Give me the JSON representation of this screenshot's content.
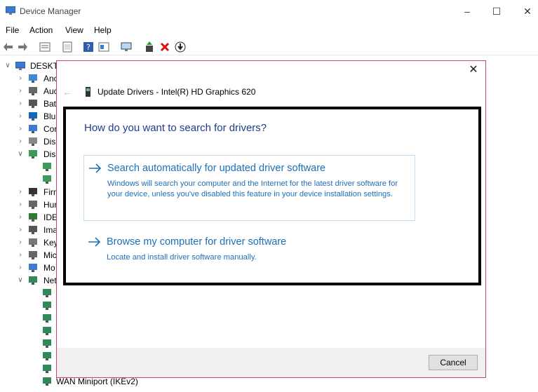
{
  "window": {
    "title": "Device Manager"
  },
  "menu": [
    "File",
    "Action",
    "View",
    "Help"
  ],
  "tree": {
    "root": "DESKTC",
    "items": [
      {
        "label": "Anc",
        "icon": "audio-io-icon",
        "expanded": false
      },
      {
        "label": "Auc",
        "icon": "speaker-icon",
        "expanded": false
      },
      {
        "label": "Bat",
        "icon": "battery-icon",
        "expanded": false
      },
      {
        "label": "Blu",
        "icon": "bluetooth-icon",
        "expanded": false
      },
      {
        "label": "Cor",
        "icon": "computer-icon",
        "expanded": false
      },
      {
        "label": "Disl",
        "icon": "disk-drive-icon",
        "expanded": false
      },
      {
        "label": "Disp",
        "icon": "display-adapter-icon",
        "expanded": true
      },
      {
        "label": "",
        "icon": "display-adapter-icon",
        "child": true
      },
      {
        "label": "",
        "icon": "display-adapter-icon",
        "child": true
      },
      {
        "label": "Firm",
        "icon": "firmware-icon",
        "expanded": false
      },
      {
        "label": "Hur",
        "icon": "hid-icon",
        "expanded": false
      },
      {
        "label": "IDE",
        "icon": "ide-controller-icon",
        "expanded": false
      },
      {
        "label": "Ima",
        "icon": "camera-icon",
        "expanded": false
      },
      {
        "label": "Key",
        "icon": "keyboard-icon",
        "expanded": false
      },
      {
        "label": "Mic",
        "icon": "mouse-icon",
        "expanded": false
      },
      {
        "label": "Mo",
        "icon": "monitor-icon",
        "expanded": false
      },
      {
        "label": "Net",
        "icon": "network-adapter-icon",
        "expanded": true
      },
      {
        "label": "",
        "icon": "network-adapter-icon",
        "child": true
      },
      {
        "label": "",
        "icon": "network-adapter-icon",
        "child": true
      },
      {
        "label": "",
        "icon": "network-adapter-icon",
        "child": true
      },
      {
        "label": "",
        "icon": "network-adapter-icon",
        "child": true
      },
      {
        "label": "",
        "icon": "network-adapter-icon",
        "child": true
      },
      {
        "label": "",
        "icon": "network-adapter-icon",
        "child": true
      },
      {
        "label": "",
        "icon": "network-adapter-icon",
        "child": true
      },
      {
        "label": "WAN Miniport (IKEv2)",
        "icon": "network-adapter-icon",
        "child": true
      }
    ]
  },
  "dialog": {
    "title": "Update Drivers - Intel(R) HD Graphics 620",
    "question": "How do you want to search for drivers?",
    "option1": {
      "heading": "Search automatically for updated driver software",
      "description": "Windows will search your computer and the Internet for the latest driver software for your device, unless you've disabled this feature in your device installation settings."
    },
    "option2": {
      "heading": "Browse my computer for driver software",
      "description": "Locate and install driver software manually."
    },
    "cancel_label": "Cancel"
  },
  "colors": {
    "accent_link": "#1d6fb8",
    "question": "#1f3c8a",
    "dialog_border": "#c5417d"
  }
}
